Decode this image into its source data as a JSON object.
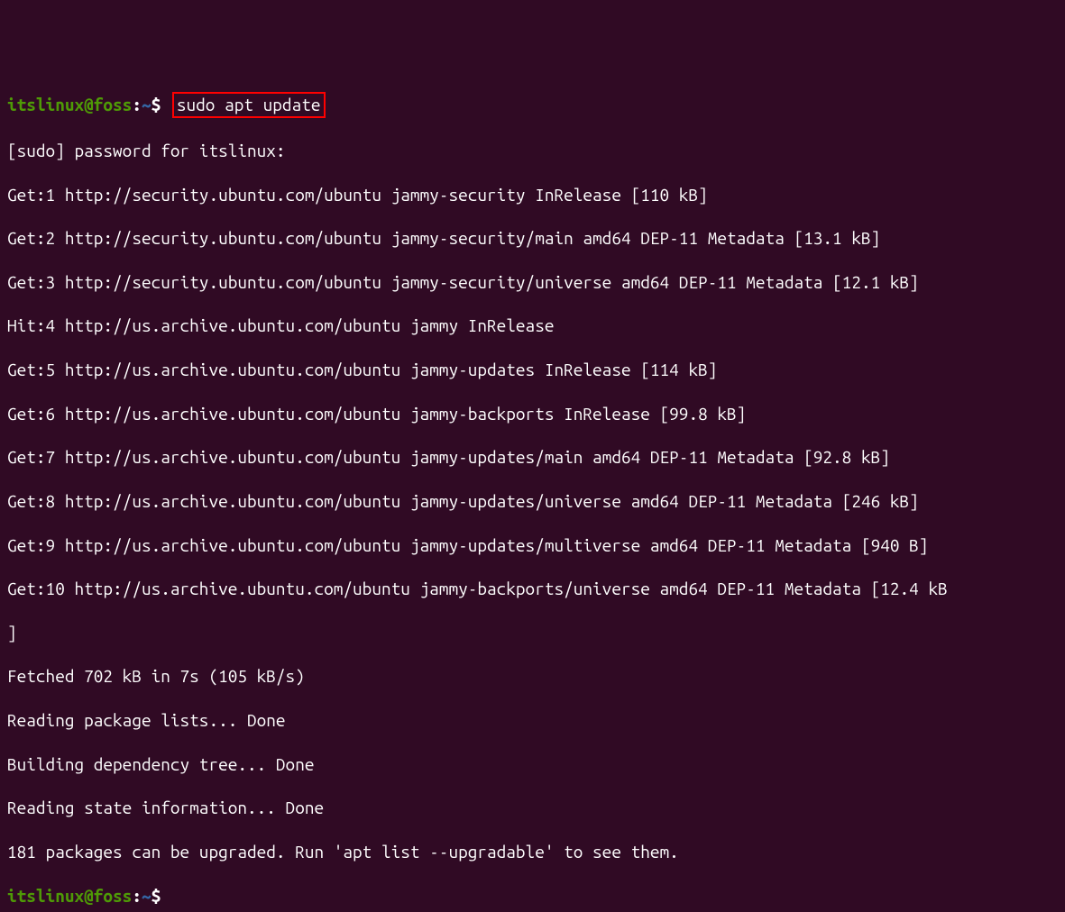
{
  "prompt1": {
    "user": "itslinux@foss",
    "colon": ":",
    "path": "~",
    "symbol": "$",
    "command": "sudo apt update"
  },
  "output": [
    "[sudo] password for itslinux:",
    "Get:1 http://security.ubuntu.com/ubuntu jammy-security InRelease [110 kB]",
    "Get:2 http://security.ubuntu.com/ubuntu jammy-security/main amd64 DEP-11 Metadata [13.1 kB]",
    "Get:3 http://security.ubuntu.com/ubuntu jammy-security/universe amd64 DEP-11 Metadata [12.1 kB]",
    "Hit:4 http://us.archive.ubuntu.com/ubuntu jammy InRelease",
    "Get:5 http://us.archive.ubuntu.com/ubuntu jammy-updates InRelease [114 kB]",
    "Get:6 http://us.archive.ubuntu.com/ubuntu jammy-backports InRelease [99.8 kB]",
    "Get:7 http://us.archive.ubuntu.com/ubuntu jammy-updates/main amd64 DEP-11 Metadata [92.8 kB]",
    "Get:8 http://us.archive.ubuntu.com/ubuntu jammy-updates/universe amd64 DEP-11 Metadata [246 kB]",
    "Get:9 http://us.archive.ubuntu.com/ubuntu jammy-updates/multiverse amd64 DEP-11 Metadata [940 B]",
    "Get:10 http://us.archive.ubuntu.com/ubuntu jammy-backports/universe amd64 DEP-11 Metadata [12.4 kB",
    "]",
    "Fetched 702 kB in 7s (105 kB/s)",
    "Reading package lists... Done",
    "Building dependency tree... Done",
    "Reading state information... Done",
    "181 packages can be upgraded. Run 'apt list --upgradable' to see them."
  ],
  "prompt2": {
    "user": "itslinux@foss",
    "colon": ":",
    "path": "~",
    "symbol": "$"
  }
}
